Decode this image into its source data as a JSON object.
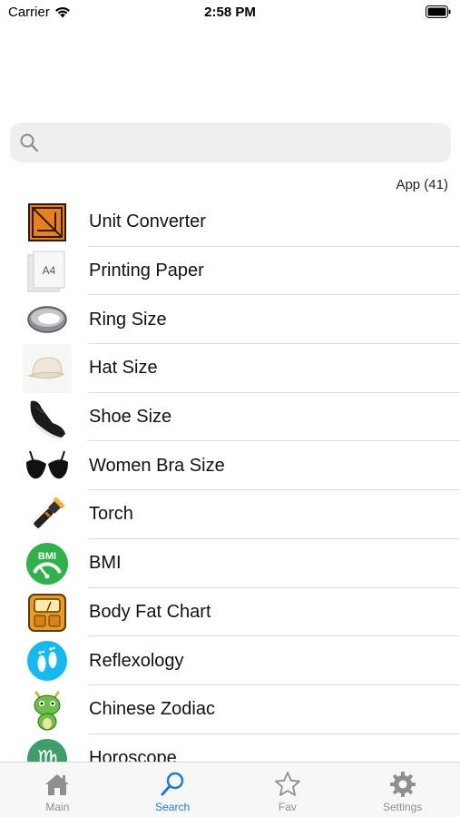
{
  "status_bar": {
    "carrier": "Carrier",
    "time": "2:58 PM"
  },
  "search": {
    "placeholder": "",
    "value": ""
  },
  "section_header": "App (41)",
  "items": [
    {
      "label": "Unit Converter",
      "icon": "unit-converter-icon"
    },
    {
      "label": "Printing Paper",
      "icon": "a4-paper-icon",
      "icon_text": "A4"
    },
    {
      "label": "Ring Size",
      "icon": "ring-icon"
    },
    {
      "label": "Hat Size",
      "icon": "cap-icon"
    },
    {
      "label": "Shoe Size",
      "icon": "sneaker-icon"
    },
    {
      "label": "Women Bra Size",
      "icon": "bra-icon"
    },
    {
      "label": "Torch",
      "icon": "flashlight-icon"
    },
    {
      "label": "BMI",
      "icon": "bmi-gauge-icon",
      "icon_text": "BMI"
    },
    {
      "label": "Body Fat Chart",
      "icon": "scale-icon"
    },
    {
      "label": "Reflexology",
      "icon": "footprints-icon"
    },
    {
      "label": "Chinese Zodiac",
      "icon": "dragon-icon"
    },
    {
      "label": "Horoscope",
      "icon": "virgo-icon",
      "icon_text": "♍"
    }
  ],
  "tabs": [
    {
      "label": "Main",
      "icon": "house-icon",
      "active": false
    },
    {
      "label": "Search",
      "icon": "magnifier-icon",
      "active": true
    },
    {
      "label": "Fav",
      "icon": "star-icon",
      "active": false
    },
    {
      "label": "Settings",
      "icon": "gear-icon",
      "active": false
    }
  ],
  "colors": {
    "accent": "#1a7bd8",
    "tab_inactive": "#8e8e93",
    "search_bg": "#efeff0"
  }
}
